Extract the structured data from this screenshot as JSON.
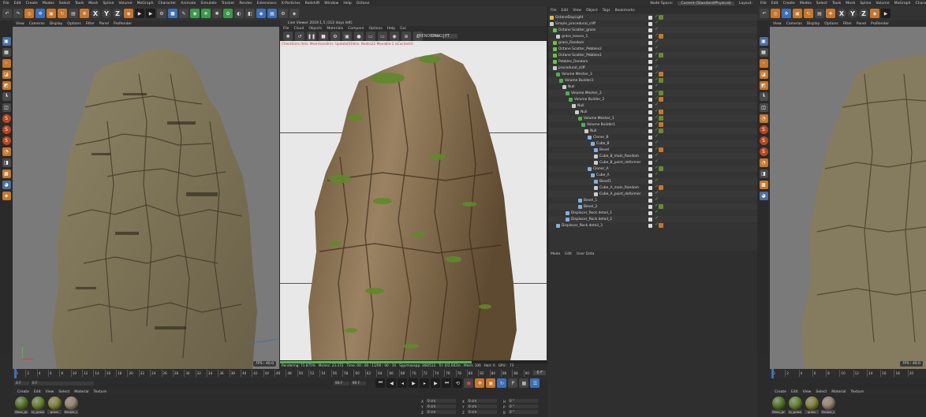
{
  "menus": {
    "left": [
      "File",
      "Edit",
      "Create",
      "Modes",
      "Select",
      "Tools",
      "Mesh",
      "Spline",
      "Volume",
      "MoGraph",
      "Character",
      "Animate",
      "Simulate",
      "Tracker",
      "Render",
      "Extensions",
      "X-Particles",
      "Redshift",
      "Window",
      "Help",
      "Octane"
    ],
    "right": [
      "File",
      "Edit",
      "Create",
      "Modes",
      "Select",
      "Tools",
      "Mesh",
      "Spline",
      "Volume",
      "MoGraph",
      "Character",
      "Animate",
      "Simulate",
      "Tracker",
      "Render",
      "Extensions",
      "X-Particles",
      "Redshift",
      "Window",
      "Help",
      "Octane"
    ],
    "node_space_label": "Node Space:",
    "node_space_value": "Current (Standard/Physical)",
    "layout_label": "Layout:"
  },
  "toolbar": {
    "axis": [
      "X",
      "Y",
      "Z"
    ]
  },
  "viewport_menu": [
    "View",
    "Cameras",
    "Display",
    "Options",
    "Filter",
    "Panel",
    "ProRender"
  ],
  "viewport_left": {
    "fps": "FPS : 40.0",
    "bg": "#787878"
  },
  "viewport_right": {
    "fps": "FPS : 40.0"
  },
  "live_viewer": {
    "title": "Live Viewer 2019.1.5 (112 days left)",
    "menu": [
      "File",
      "Cloud",
      "Objects",
      "Materials",
      "Compare",
      "Options",
      "Help",
      "Gui"
    ],
    "status": "[RENDERING]",
    "channel_label": "Chs:",
    "channel_value": "PT",
    "warning": "CheckSims /Ims. MeshGendims. Update[0]dms. Nodes22 Movable:1 isCached:0",
    "footer": [
      "Rendering: 71.875%",
      "Ms/sec: 23.372",
      "Time: 00 : 00 : 11/00 : 00 : 16",
      "Spp/maxspp: 368/512",
      "Tri: 0/2.602m",
      "Mesh: 106",
      "Hair: 0",
      "GPU:",
      "73"
    ],
    "progress": 0.72
  },
  "object_manager": {
    "menu": [
      "File",
      "Edit",
      "View",
      "Object",
      "Tags",
      "Bookmarks"
    ],
    "rows": [
      {
        "name": "OctaneDayLight",
        "indent": 0,
        "icon": "#e8c040"
      },
      {
        "name": "Simple_procedural_cliff",
        "indent": 0,
        "icon": "#cccccc"
      },
      {
        "name": "Octane Scatter_grass",
        "indent": 1,
        "icon": "#6fbf4a"
      },
      {
        "name": "grass_leaves_1",
        "indent": 2,
        "icon": "#cccccc"
      },
      {
        "name": "grass_Random",
        "indent": 1,
        "icon": "#6fbf4a"
      },
      {
        "name": "Octane Scatter_Pebbles2",
        "indent": 1,
        "icon": "#6fbf4a"
      },
      {
        "name": "Octane Scatter_Pebbles1",
        "indent": 1,
        "icon": "#6fbf4a"
      },
      {
        "name": "Pebbles_Random",
        "indent": 1,
        "icon": "#6fbf4a"
      },
      {
        "name": "procedural_cliff",
        "indent": 1,
        "icon": "#cccccc"
      },
      {
        "name": "Volume Mesher_3",
        "indent": 2,
        "icon": "#4fb04f"
      },
      {
        "name": "Volume Builder3",
        "indent": 3,
        "icon": "#4fb04f"
      },
      {
        "name": "Null",
        "indent": 4,
        "icon": "#cccccc"
      },
      {
        "name": "Volume Mesher_2",
        "indent": 5,
        "icon": "#4fb04f"
      },
      {
        "name": "Volume Builder_2",
        "indent": 6,
        "icon": "#4fb04f"
      },
      {
        "name": "Null",
        "indent": 7,
        "icon": "#cccccc"
      },
      {
        "name": "Null",
        "indent": 8,
        "icon": "#cccccc"
      },
      {
        "name": "Volume Mesher_1",
        "indent": 9,
        "icon": "#4fb04f"
      },
      {
        "name": "Volume Builder1",
        "indent": 10,
        "icon": "#4fb04f"
      },
      {
        "name": "Null",
        "indent": 11,
        "icon": "#cccccc"
      },
      {
        "name": "Cloner_B",
        "indent": 12,
        "icon": "#7fb0e0"
      },
      {
        "name": "Cube_B",
        "indent": 13,
        "icon": "#7fb0e0"
      },
      {
        "name": "Bevel",
        "indent": 14,
        "icon": "#7fb0e0"
      },
      {
        "name": "Cube_B_main_Random",
        "indent": 14,
        "icon": "#cccccc"
      },
      {
        "name": "Cube_B_point_deformer",
        "indent": 14,
        "icon": "#cccccc"
      },
      {
        "name": "Cloner_A",
        "indent": 12,
        "icon": "#7fb0e0"
      },
      {
        "name": "Cube_A",
        "indent": 13,
        "icon": "#7fb0e0"
      },
      {
        "name": "Bevel1",
        "indent": 14,
        "icon": "#7fb0e0"
      },
      {
        "name": "Cube_A_main_Random",
        "indent": 14,
        "icon": "#cccccc"
      },
      {
        "name": "Cube_A_point_deformer",
        "indent": 14,
        "icon": "#cccccc"
      },
      {
        "name": "Bevel_1",
        "indent": 9,
        "icon": "#7fb0e0"
      },
      {
        "name": "Bevel_2",
        "indent": 9,
        "icon": "#7fb0e0"
      },
      {
        "name": "Displacer_Rock detail_1",
        "indent": 5,
        "icon": "#7fb0e0"
      },
      {
        "name": "Displacer_Rock detail_2",
        "indent": 5,
        "icon": "#7fb0e0"
      },
      {
        "name": "Displacer_Rock detail_3",
        "indent": 2,
        "icon": "#7fb0e0"
      }
    ]
  },
  "attribute_manager": {
    "menu": [
      "Mode",
      "Edit",
      "User Data"
    ]
  },
  "timeline": {
    "ticks": [
      "0",
      "2",
      "4",
      "6",
      "8",
      "10",
      "12",
      "14",
      "16",
      "18",
      "20",
      "22",
      "24",
      "26",
      "28",
      "30",
      "32",
      "34",
      "36",
      "38",
      "40",
      "42",
      "44",
      "46",
      "48",
      "50",
      "52",
      "54",
      "56",
      "58",
      "60",
      "62",
      "64",
      "66",
      "68",
      "70",
      "72",
      "74",
      "76",
      "78",
      "80",
      "82",
      "84",
      "86",
      "88",
      "90"
    ],
    "ticks_right": [
      "0",
      "2",
      "4",
      "6",
      "8",
      "10",
      "12",
      "14",
      "16",
      "18",
      "20"
    ],
    "current_frame": "0 F",
    "start_frame": "0 F",
    "end_frame": "90 F",
    "end_frame2": "90 F",
    "frame_tag": "0 F"
  },
  "material_bar": {
    "menu": [
      "Create",
      "Edit",
      "View",
      "Select",
      "Material",
      "Texture"
    ]
  },
  "materials": [
    {
      "name": "Moss_gr",
      "color": "#5a7a2a"
    },
    {
      "name": "ty_grass",
      "color": "#6a8a30"
    },
    {
      "name": "grass",
      "color": "#8a8a3a"
    },
    {
      "name": "Simple_c",
      "color": "#9a8a70"
    }
  ],
  "coords": {
    "labels": [
      "X",
      "Y",
      "Z"
    ],
    "values": [
      "0 cm",
      "0 cm",
      "0 cm"
    ],
    "labels2": [
      "X",
      "Y",
      "Z"
    ],
    "values2": [
      "0 cm",
      "0 cm",
      "0 cm"
    ],
    "labels3": [
      "H",
      "P",
      "B"
    ],
    "values3": [
      "0 °",
      "0 °",
      "0 °"
    ]
  }
}
